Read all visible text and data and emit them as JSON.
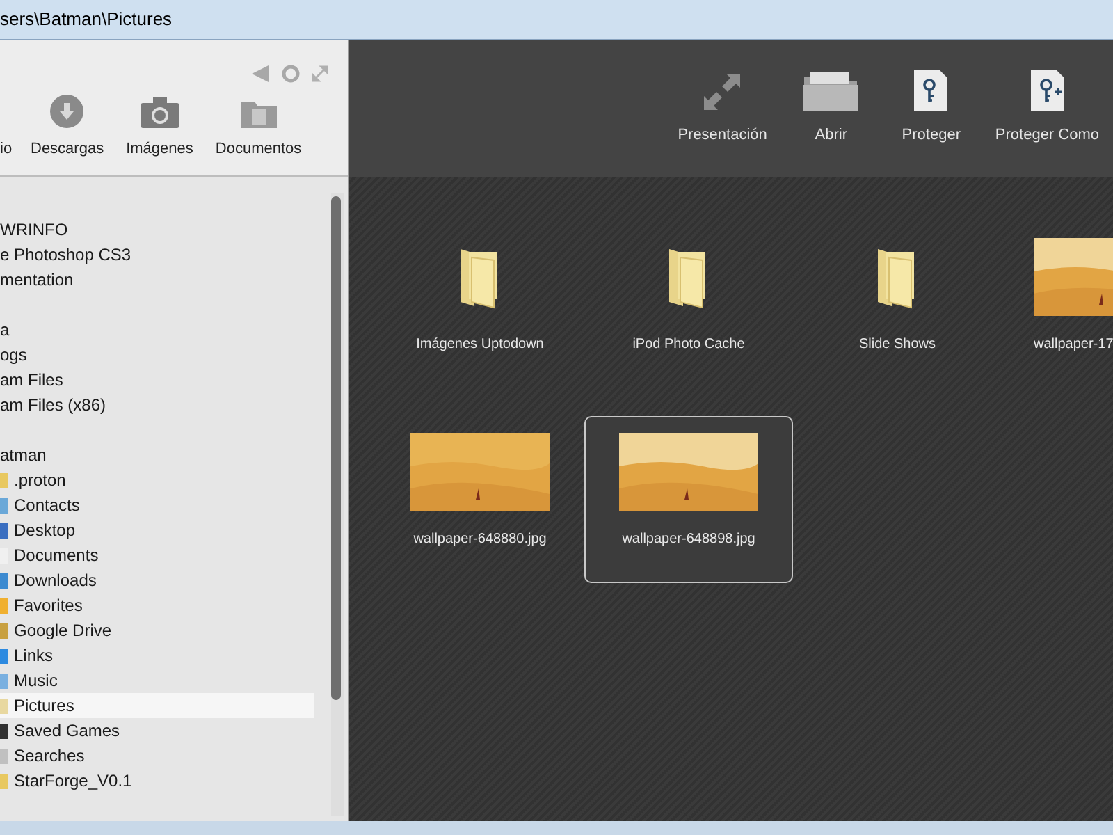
{
  "window": {
    "title": "sers\\Batman\\Pictures"
  },
  "left_toolbar": {
    "buttons": [
      {
        "kind": "partial",
        "label": "io"
      },
      {
        "kind": "download",
        "label": "Descargas"
      },
      {
        "kind": "camera",
        "label": "Imágenes"
      },
      {
        "kind": "documents",
        "label": "Documentos"
      }
    ]
  },
  "sidebar": {
    "groups": [
      {
        "items": [
          {
            "label": "WRINFO",
            "selected": false
          },
          {
            "label": "e Photoshop CS3",
            "selected": false
          },
          {
            "label": "mentation",
            "selected": false
          }
        ]
      },
      {
        "items": [
          {
            "label": "a",
            "selected": false
          },
          {
            "label": "ogs",
            "selected": false
          },
          {
            "label": "am Files",
            "selected": false
          },
          {
            "label": "am Files (x86)",
            "selected": false
          }
        ]
      },
      {
        "items": [
          {
            "label": "atman",
            "selected": false,
            "children": [
              {
                "label": ".proton",
                "selected": false,
                "color": "#e8c860"
              },
              {
                "label": "Contacts",
                "selected": false,
                "color": "#6aa8d8"
              },
              {
                "label": "Desktop",
                "selected": false,
                "color": "#3a6ec0"
              },
              {
                "label": "Documents",
                "selected": false,
                "color": "#f0f0f0"
              },
              {
                "label": "Downloads",
                "selected": false,
                "color": "#3c8ad0"
              },
              {
                "label": "Favorites",
                "selected": false,
                "color": "#f0b030"
              },
              {
                "label": "Google Drive",
                "selected": false,
                "color": "#c8a040"
              },
              {
                "label": "Links",
                "selected": false,
                "color": "#2d8ae0"
              },
              {
                "label": "Music",
                "selected": false,
                "color": "#7ab0e0"
              },
              {
                "label": "Pictures",
                "selected": true,
                "color": "#e8d8a0"
              },
              {
                "label": "Saved Games",
                "selected": false,
                "color": "#303030"
              },
              {
                "label": "Searches",
                "selected": false,
                "color": "#c0c0c0"
              },
              {
                "label": "StarForge_V0.1",
                "selected": false,
                "color": "#e8c860"
              }
            ]
          }
        ]
      }
    ]
  },
  "right_toolbar": {
    "buttons": [
      {
        "kind": "expand",
        "label": "Presentación"
      },
      {
        "kind": "folder",
        "label": "Abrir"
      },
      {
        "kind": "key",
        "label": "Proteger"
      },
      {
        "kind": "key-plus",
        "label": "Proteger Como"
      }
    ]
  },
  "files": [
    {
      "kind": "folder",
      "name": "Imágenes Uptodown",
      "selected": false
    },
    {
      "kind": "folder",
      "name": "iPod Photo Cache",
      "selected": false
    },
    {
      "kind": "folder",
      "name": "Slide Shows",
      "selected": false
    },
    {
      "kind": "image",
      "name": "wallpaper-17",
      "selected": false
    },
    {
      "kind": "image",
      "name": "wallpaper-648880.jpg",
      "selected": false
    },
    {
      "kind": "image",
      "name": "wallpaper-648898.jpg",
      "selected": true
    }
  ]
}
